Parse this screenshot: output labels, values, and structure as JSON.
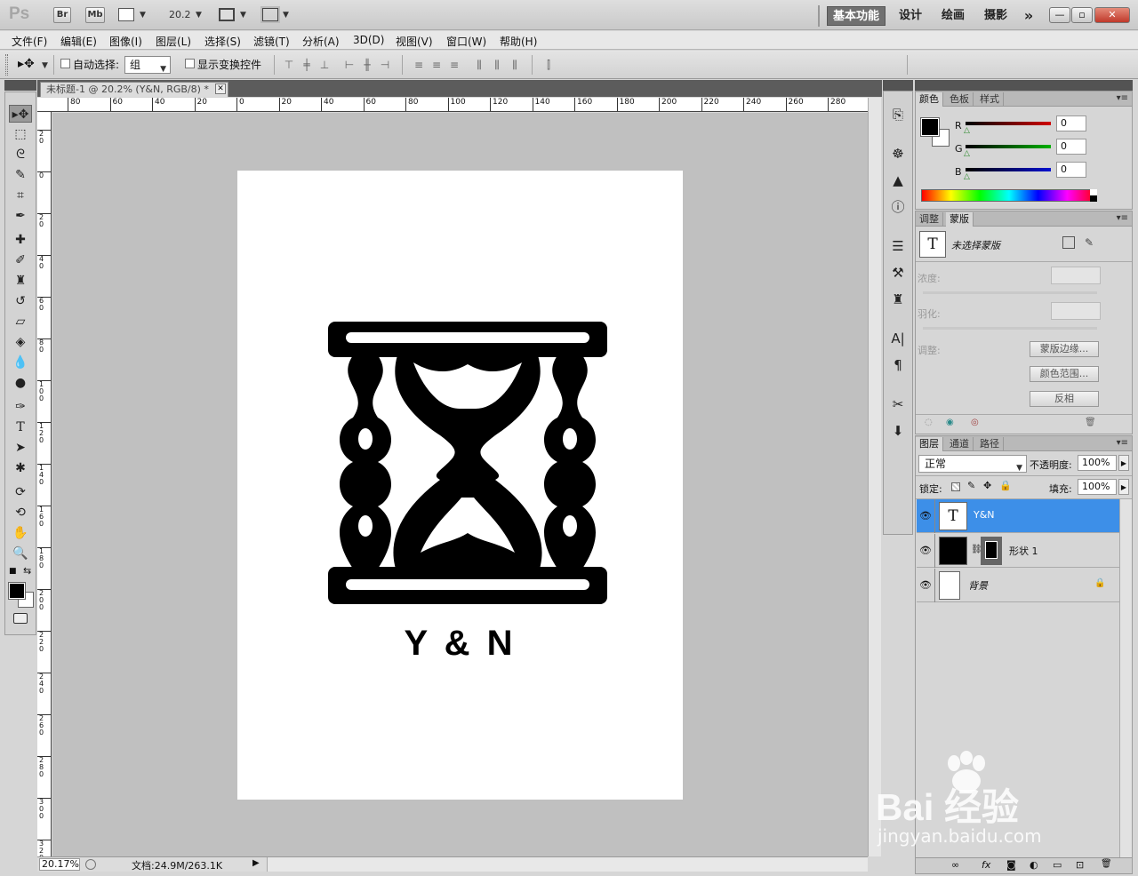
{
  "app": {
    "logo": "Ps",
    "bridge_btn": "Br",
    "minibridge_btn": "Mb",
    "zoom_level": "20.2",
    "workspaces": [
      "基本功能",
      "设计",
      "绘画",
      "摄影"
    ],
    "more": "»",
    "window_buttons": [
      "—",
      "▫",
      "✕"
    ]
  },
  "menu": [
    "文件(F)",
    "编辑(E)",
    "图像(I)",
    "图层(L)",
    "选择(S)",
    "滤镜(T)",
    "分析(A)",
    "3D(D)",
    "视图(V)",
    "窗口(W)",
    "帮助(H)"
  ],
  "options": {
    "auto_select_label": "自动选择:",
    "auto_select_value": "组",
    "show_transform_label": "显示变换控件"
  },
  "document": {
    "tab_title": "未标题-1 @ 20.2% (Y&N, RGB/8) *",
    "tab_close": "✕",
    "logo_text": "Y & N",
    "ruler_h_labels": [
      "80",
      "60",
      "40",
      "20",
      "0",
      "20",
      "40",
      "60",
      "80",
      "100",
      "120",
      "140",
      "160",
      "180",
      "200",
      "220",
      "240",
      "260",
      "280"
    ],
    "ruler_v_labels": [
      "20",
      "0",
      "20",
      "40",
      "60",
      "80",
      "100",
      "120",
      "140",
      "160",
      "180",
      "200",
      "220",
      "240",
      "260",
      "280",
      "300",
      "320"
    ],
    "status_zoom": "20.17%",
    "status_info": "文档:24.9M/263.1K"
  },
  "color_panel": {
    "tabs": [
      "颜色",
      "色板",
      "样式"
    ],
    "channels": [
      {
        "label": "R",
        "value": "0",
        "color": "#d00000"
      },
      {
        "label": "G",
        "value": "0",
        "color": "#00b000"
      },
      {
        "label": "B",
        "value": "0",
        "color": "#0010d0"
      }
    ]
  },
  "mask_panel": {
    "tabs": [
      "调整",
      "蒙版"
    ],
    "no_mask_label": "未选择蒙版",
    "density_label": "浓度:",
    "feather_label": "羽化:",
    "adjust_label": "调整:",
    "buttons": [
      "蒙版边缘...",
      "颜色范围...",
      "反相"
    ]
  },
  "layers_panel": {
    "tabs": [
      "图层",
      "通道",
      "路径"
    ],
    "blend_mode": "正常",
    "opacity_label": "不透明度:",
    "opacity_value": "100%",
    "lock_label": "锁定:",
    "fill_label": "填充:",
    "fill_value": "100%",
    "layers": [
      {
        "name": "Y&N",
        "thumb": "T",
        "selected": true
      },
      {
        "name": "形状 1",
        "thumb": "",
        "selected": false
      },
      {
        "name": "背景",
        "thumb": "",
        "selected": false
      }
    ],
    "footer_icons": [
      "∞",
      "fx",
      "◙",
      "◐",
      "▭",
      "⊡",
      "🗑"
    ]
  },
  "watermark": {
    "brand": "Bai 经验",
    "url": "jingyan.baidu.com"
  }
}
